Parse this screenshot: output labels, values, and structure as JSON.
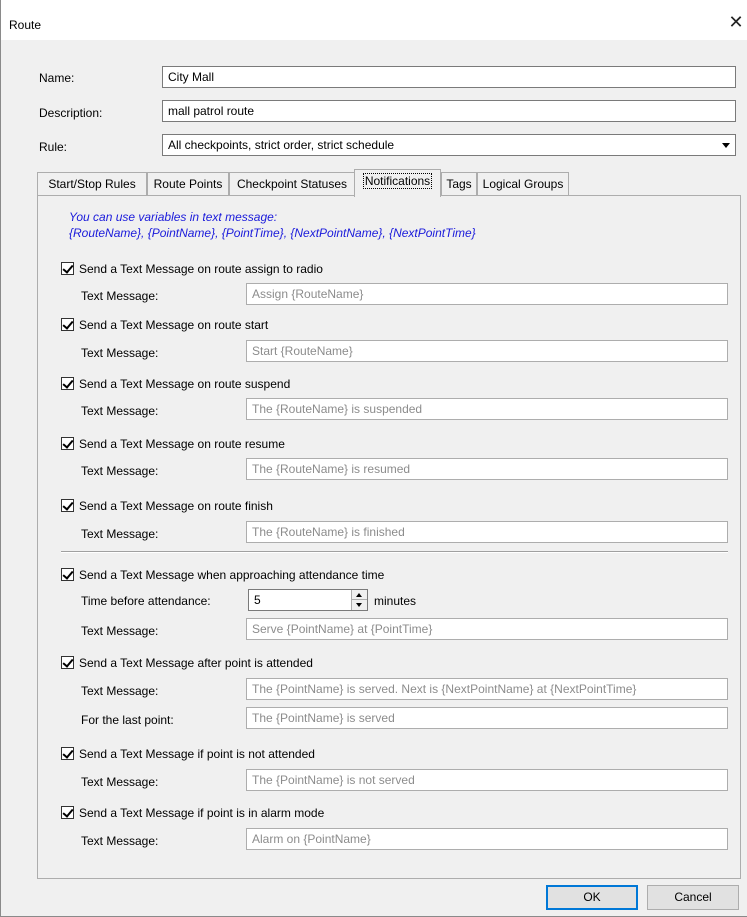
{
  "window": {
    "title": "Route"
  },
  "form": {
    "name_label": "Name:",
    "name_value": "City Mall",
    "description_label": "Description:",
    "description_value": "mall patrol route",
    "rule_label": "Rule:",
    "rule_value": "All checkpoints, strict order, strict schedule"
  },
  "tabs": [
    "Start/Stop Rules",
    "Route Points",
    "Checkpoint Statuses",
    "Notifications",
    "Tags",
    "Logical Groups"
  ],
  "notifications": {
    "hint_line1": "You can use variables in text message:",
    "hint_line2": "{RouteName}, {PointName}, {PointTime}, {NextPointName}, {NextPointTime}",
    "text_message_label": "Text Message:",
    "items": [
      {
        "label": "Send a Text Message on route assign to radio",
        "checked": true,
        "message": "Assign {RouteName}"
      },
      {
        "label": "Send a Text Message on route start",
        "checked": true,
        "message": "Start {RouteName}"
      },
      {
        "label": "Send a Text Message on route suspend",
        "checked": true,
        "message": "The {RouteName} is suspended"
      },
      {
        "label": "Send a Text Message on route resume",
        "checked": true,
        "message": "The {RouteName} is resumed"
      },
      {
        "label": "Send a Text Message on route finish",
        "checked": true,
        "message": "The {RouteName} is finished"
      }
    ],
    "approaching": {
      "label": "Send a Text Message when approaching attendance time",
      "checked": true,
      "time_label": "Time before attendance:",
      "time_value": "5",
      "time_unit": "minutes",
      "message": "Serve {PointName} at {PointTime}"
    },
    "after_attended": {
      "label": "Send a Text Message after point is attended",
      "checked": true,
      "message": "The {PointName} is served. Next is {NextPointName} at {NextPointTime}",
      "last_point_label": "For the last point:",
      "last_point_message": "The {PointName} is served"
    },
    "not_attended": {
      "label": "Send a Text Message if point is not attended",
      "checked": true,
      "message": "The {PointName} is not served"
    },
    "alarm": {
      "label": "Send a Text Message if point is in alarm mode",
      "checked": true,
      "message": "Alarm on {PointName}"
    }
  },
  "buttons": {
    "ok": "OK",
    "cancel": "Cancel"
  }
}
